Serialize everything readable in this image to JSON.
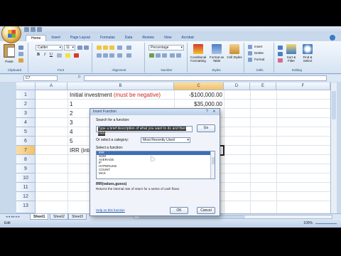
{
  "ribbon": {
    "tabs": [
      "Home",
      "Insert",
      "Page Layout",
      "Formulas",
      "Data",
      "Review",
      "View",
      "Acrobat"
    ],
    "font_name": "Calibri",
    "font_size": "11",
    "number_format": "Percentage",
    "groups": [
      "Clipboard",
      "Font",
      "Alignment",
      "Number",
      "Styles",
      "Cells",
      "Editing"
    ],
    "paste_label": "Paste",
    "styles_buttons": [
      "Conditional Formatting",
      "Format as Table",
      "Cell Styles"
    ],
    "cells_buttons": [
      "Insert",
      "Delete",
      "Format"
    ],
    "editing_buttons": [
      "Sort & Filter",
      "Find & Select"
    ]
  },
  "formula_bar": {
    "name_box": "C7",
    "fx": "fx"
  },
  "columns": [
    "A",
    "B",
    "C",
    "D",
    "E",
    "F"
  ],
  "rows": [
    "1",
    "2",
    "3",
    "4",
    "5",
    "6",
    "7",
    "8",
    "9",
    "10",
    "11",
    "12",
    "13"
  ],
  "cells": {
    "b1": "Initial investment ",
    "b1_red": "(must be negative)",
    "c1": "-$100,000.00",
    "b2": "1",
    "c2": "$35,000.00",
    "b3": "2",
    "b4": "3",
    "b5": "4",
    "b6": "5",
    "b7": "IRR (internal ra"
  },
  "sheets": [
    "Sheet1",
    "Sheet2",
    "Sheet3"
  ],
  "status": {
    "mode": "Edit",
    "zoom": "100%"
  },
  "dialog": {
    "title": "Insert Function",
    "search_label": "Search for a function:",
    "search_value": "Type a brief description of what you want to do and then click",
    "go_label": "Go",
    "category_label": "Or select a category:",
    "category_value": "Most Recently Used",
    "select_label": "Select a function:",
    "functions": [
      "IRR",
      "SUM",
      "AVERAGE",
      "IF",
      "HYPERLINK",
      "COUNT",
      "MAX"
    ],
    "signature": "IRR(values,guess)",
    "description": "Returns the internal rate of return for a series of cash flows.",
    "help_link": "Help on this function",
    "ok_label": "OK",
    "cancel_label": "Cancel",
    "help_glyph": "?",
    "close_glyph": "✕"
  }
}
